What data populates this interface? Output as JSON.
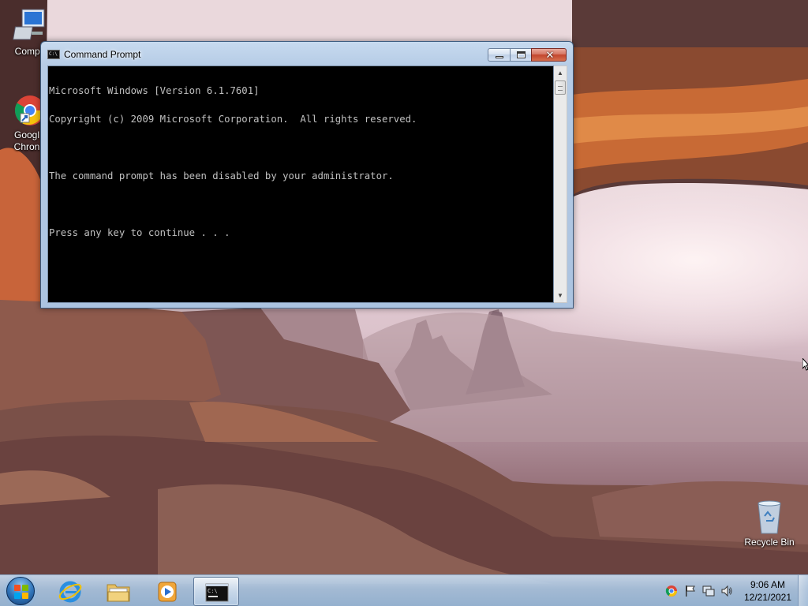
{
  "desktop": {
    "icons": [
      {
        "label": "Compu",
        "kind": "computer"
      },
      {
        "label": "Googl\nChron",
        "kind": "chrome-shortcut"
      },
      {
        "label": "Recycle Bin",
        "kind": "recycle-bin"
      }
    ]
  },
  "window": {
    "title": "Command Prompt",
    "buttons": {
      "minimize": "minimize",
      "maximize": "maximize",
      "close": "✕"
    },
    "console_lines": [
      "Microsoft Windows [Version 6.1.7601]",
      "Copyright (c) 2009 Microsoft Corporation.  All rights reserved.",
      "",
      "The command prompt has been disabled by your administrator.",
      "",
      "Press any key to continue . . ."
    ],
    "scroll_position": 0.0
  },
  "taskbar": {
    "pinned": [
      {
        "name": "Internet Explorer",
        "icon": "internet-explorer-icon"
      },
      {
        "name": "Windows Explorer",
        "icon": "folder-icon"
      },
      {
        "name": "Windows Media Player",
        "icon": "media-player-icon"
      },
      {
        "name": "Command Prompt",
        "icon": "command-prompt-icon",
        "active": true
      }
    ],
    "tray_icons": [
      "chrome-icon",
      "action-center-flag-icon",
      "network-icon",
      "volume-icon"
    ],
    "clock": {
      "time": "9:06 AM",
      "date": "12/21/2021"
    }
  },
  "colors": {
    "console_bg": "#000000",
    "console_text": "#c0c0c0",
    "window_frame": "#b6cce6",
    "close_button": "#c2452d",
    "taskbar": "#a8c4e0"
  }
}
